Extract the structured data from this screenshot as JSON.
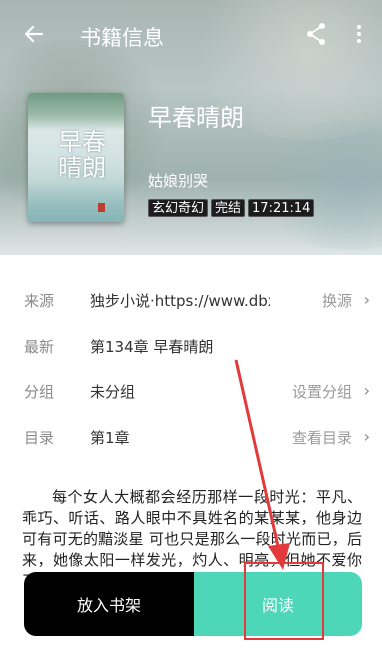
{
  "header": {
    "title": "书籍信息",
    "back_icon": "arrow-left-icon",
    "share_icon": "share-icon",
    "more_icon": "more-vertical-icon"
  },
  "book": {
    "cover_title": "早春晴朗",
    "name": "早春晴朗",
    "author": "姑娘别哭",
    "tags": [
      "玄幻奇幻",
      "完结",
      "17:21:14"
    ]
  },
  "info": [
    {
      "label": "来源",
      "value": "独步小说·https://www.dbxs...",
      "action": "换源"
    },
    {
      "label": "最新",
      "value": "第134章 早春晴朗",
      "action": ""
    },
    {
      "label": "分组",
      "value": "未分组",
      "action": "设置分组"
    },
    {
      "label": "目录",
      "value": "第1章",
      "action": "查看目录"
    }
  ],
  "intro": "每个女人大概都会经历那样一段时光：平凡、乖巧、听话、路人眼中不具姓名的某某某，他身边可有可无的黯淡星 可也只是那么一段时光而已，后来，她像太阳一样发光，灼人、明亮，但她不爱你了 安念站在北国的冰天雪地之中",
  "buttons": {
    "add_shelf": "放入书架",
    "read": "阅读"
  },
  "colors": {
    "accent": "#4ed6b9",
    "annotation": "#e23a3a"
  }
}
